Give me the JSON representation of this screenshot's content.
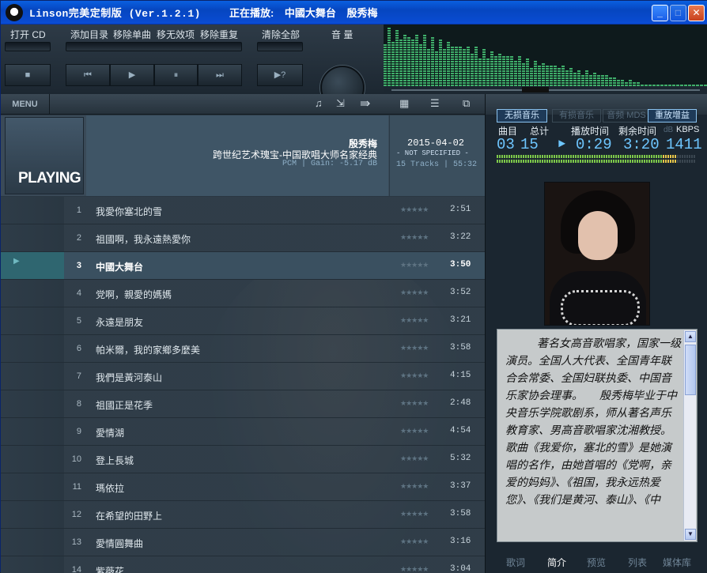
{
  "window": {
    "title": "Linson完美定制版 (Ver.1.2.1)",
    "now_playing_label": "正在播放:",
    "now_playing_track": "中國大舞台",
    "now_playing_artist": "殷秀梅",
    "buttons": {
      "minimize": "_",
      "maximize": "□",
      "close": "✕"
    }
  },
  "toolbar": {
    "open_cd": "打开 CD",
    "add_dir": "添加目录",
    "remove_single": "移除单曲",
    "remove_invalid": "移无效项",
    "remove_dup": "移除重复",
    "clear_all": "清除全部",
    "volume": "音 量",
    "stop_icon": "■",
    "prev_icon": "⏮",
    "play_icon": "▶",
    "pause_icon": "⏸",
    "next_icon": "⏭",
    "random_icon": "▶?"
  },
  "playlist": {
    "menu_label": "MENU",
    "icons": [
      "music-note-icon",
      "import-icon",
      "forward-arrows-icon",
      "grid-view-icon",
      "list-view-icon",
      "popout-icon"
    ],
    "cover_label": "PLAYING",
    "album": {
      "artist": "殷秀梅",
      "title": "跨世纪艺术瑰宝-中国歌唱大师名家经典",
      "format": "PCM | Gain: -5.17 dB",
      "date": "2015-04-02",
      "status": "- NOT SPECIFIED -",
      "summary": "15 Tracks | 55:32"
    },
    "current_index": 3,
    "tracks": [
      {
        "num": "1",
        "name": "我愛你塞北的雪",
        "stars": "★★★★★",
        "duration": "2:51"
      },
      {
        "num": "2",
        "name": "祖國啊，我永遠熱愛你",
        "stars": "★★★★★",
        "duration": "3:22"
      },
      {
        "num": "3",
        "name": "中國大舞台",
        "stars": "★★★★★",
        "duration": "3:50"
      },
      {
        "num": "4",
        "name": "党啊，親愛的媽媽",
        "stars": "★★★★★",
        "duration": "3:52"
      },
      {
        "num": "5",
        "name": "永遠是朋友",
        "stars": "★★★★★",
        "duration": "3:21"
      },
      {
        "num": "6",
        "name": "帕米爾，我的家鄉多麼美",
        "stars": "★★★★★",
        "duration": "3:58"
      },
      {
        "num": "7",
        "name": "我們是黃河泰山",
        "stars": "★★★★★",
        "duration": "4:15"
      },
      {
        "num": "8",
        "name": "祖國正是花季",
        "stars": "★★★★★",
        "duration": "2:48"
      },
      {
        "num": "9",
        "name": "愛情湖",
        "stars": "★★★★★",
        "duration": "4:54"
      },
      {
        "num": "10",
        "name": "登上長城",
        "stars": "★★★★★",
        "duration": "5:32"
      },
      {
        "num": "11",
        "name": "瑪依拉",
        "stars": "★★★★★",
        "duration": "3:37"
      },
      {
        "num": "12",
        "name": "在希望的田野上",
        "stars": "★★★★★",
        "duration": "3:58"
      },
      {
        "num": "13",
        "name": "愛情圓舞曲",
        "stars": "★★★★★",
        "duration": "3:16"
      },
      {
        "num": "14",
        "name": "紫薇花",
        "stars": "★★★★★",
        "duration": "3:04"
      }
    ]
  },
  "info_panel": {
    "mode_buttons": [
      {
        "label": "无损音乐",
        "active": true
      },
      {
        "label": "有损音乐",
        "active": false
      },
      {
        "label": "音频 MDS",
        "active": false
      },
      {
        "label": "重放增益",
        "active": true
      }
    ],
    "headers": {
      "track": "曲目",
      "total": "总计",
      "play_time": "播放时间",
      "remaining": "剩余时间",
      "db": "dB",
      "kbps": "KBPS"
    },
    "values": {
      "track": "03",
      "total": "15",
      "play_icon": "►",
      "play_time": "0:29",
      "remaining": "3:20",
      "kbps": "1411"
    },
    "bio": "著名女高音歌唱家，国家一级演员。全国人大代表、全国青年联合会常委、全国妇联执委、中国音乐家协会理事。　　殷秀梅毕业于中央音乐学院歌剧系，师从著名声乐教育家、男高音歌唱家沈湘教授。歌曲《我爱你，塞北的雪》是她演唱的名作，由她首唱的《党啊，亲爱的妈妈》、《祖国，我永远热爱您》、《我们是黄河、泰山》、《中",
    "tabs": [
      {
        "label": "歌词",
        "active": false
      },
      {
        "label": "简介",
        "active": true
      },
      {
        "label": "预览",
        "active": false
      },
      {
        "label": "列表",
        "active": false
      },
      {
        "label": "媒体库",
        "active": false
      }
    ]
  },
  "colors": {
    "title_bar": "#0a5fe0",
    "accent_blue": "#6ec6ff",
    "vu_green": "#7dc84a",
    "vu_yellow": "#e8c64a"
  }
}
